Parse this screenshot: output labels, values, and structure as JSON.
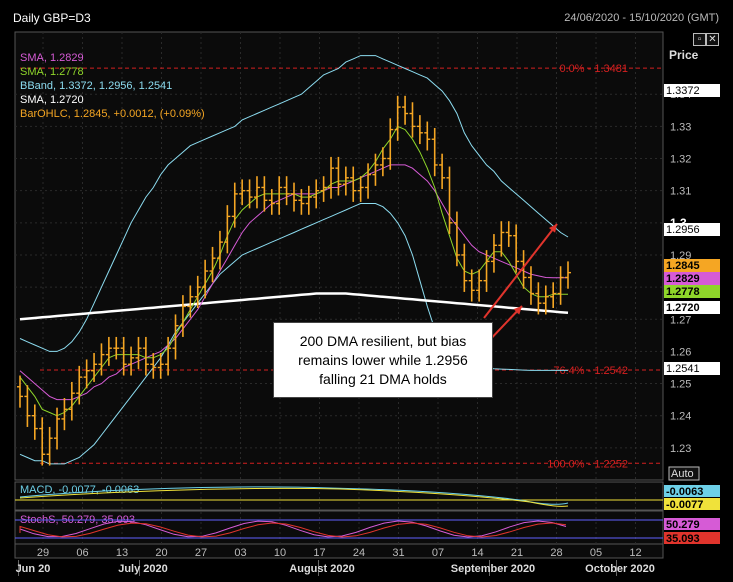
{
  "header": {
    "title": "Daily GBP=D3",
    "date_range": "24/06/2020 - 15/10/2020 (GMT)",
    "price_label": "Price",
    "auto_label": "Auto"
  },
  "legend": [
    {
      "text": "SMA, 1.2829",
      "color": "#d65bd6"
    },
    {
      "text": "SMA, 1.2778",
      "color": "#8fd62a"
    },
    {
      "text": "BBand, 1.3372, 1.2956, 1.2541",
      "color": "#8cdcf0"
    },
    {
      "text": "SMA, 1.2720",
      "color": "#ffffff"
    },
    {
      "text": "BarOHLC, 1.2845, +0.0012, (+0.09%)",
      "color": "#f5a623"
    }
  ],
  "annotation": {
    "lines": [
      "200 DMA resilient, but bias",
      "remains lower while 1.2956",
      "falling 21 DMA holds"
    ]
  },
  "colors": {
    "price": "#f5a623",
    "sma_fast": "#8fd62a",
    "sma_mid": "#d65bd6",
    "bband": "#8cdcf0",
    "sma_long": "#ffffff",
    "fib": "#d42020",
    "arrow": "#e0342c",
    "macd": "#6dd0e8",
    "signal": "#f0e23a",
    "stoch_k": "#d65bd6",
    "stoch_d": "#e0342c"
  },
  "chart_data": [
    {
      "type": "line",
      "ylim": [
        1.22,
        1.355
      ],
      "yticks": [
        1.23,
        1.24,
        1.25,
        1.26,
        1.27,
        1.28,
        1.29,
        1.3,
        1.31,
        1.32,
        1.33,
        1.34
      ],
      "xticks": [
        "29",
        "06",
        "13",
        "20",
        "27",
        "03",
        "10",
        "17",
        "24",
        "31",
        "07",
        "14",
        "21",
        "28",
        "05",
        "12"
      ],
      "months": [
        "Jun 20",
        "July 2020",
        "August 2020",
        "September 2020",
        "October 2020"
      ],
      "fib_levels": [
        {
          "label": "0.0% - 1.3481",
          "value": 1.3481
        },
        {
          "label": "76.4% - 1.2542",
          "value": 1.2542
        },
        {
          "label": "100.0% - 1.2252",
          "value": 1.2252
        }
      ],
      "price_tags": [
        {
          "text": "1.3372",
          "value": 1.3372,
          "bg": "#ffffff",
          "fg": "#000"
        },
        {
          "text": "1.2956",
          "value": 1.2956,
          "bg": "#ffffff",
          "fg": "#000"
        },
        {
          "text": "1.2845",
          "value": 1.2845,
          "bg": "#f5a623",
          "fg": "#000"
        },
        {
          "text": "1.2829",
          "value": 1.2829,
          "bg": "#d65bd6",
          "fg": "#000"
        },
        {
          "text": "1.2778",
          "value": 1.2778,
          "bg": "#8fd62a",
          "fg": "#000"
        },
        {
          "text": "1.2720",
          "value": 1.272,
          "bg": "#ffffff",
          "fg": "#000"
        },
        {
          "text": "1.2541",
          "value": 1.2541,
          "bg": "#ffffff",
          "fg": "#000"
        }
      ],
      "close": [
        1.246,
        1.24,
        1.236,
        1.228,
        1.233,
        1.239,
        1.242,
        1.247,
        1.252,
        1.254,
        1.256,
        1.259,
        1.261,
        1.261,
        1.256,
        1.258,
        1.261,
        1.256,
        1.255,
        1.256,
        1.261,
        1.268,
        1.274,
        1.277,
        1.28,
        1.285,
        1.289,
        1.294,
        1.302,
        1.309,
        1.31,
        1.308,
        1.311,
        1.307,
        1.306,
        1.311,
        1.309,
        1.307,
        1.306,
        1.308,
        1.31,
        1.311,
        1.317,
        1.312,
        1.314,
        1.31,
        1.311,
        1.315,
        1.318,
        1.32,
        1.329,
        1.336,
        1.334,
        1.33,
        1.328,
        1.326,
        1.318,
        1.314,
        1.3,
        1.29,
        1.282,
        1.279,
        1.282,
        1.288,
        1.293,
        1.297,
        1.296,
        1.288,
        1.283,
        1.278,
        1.275,
        1.277,
        1.278,
        1.283,
        1.2845
      ],
      "sma_fast": [
        1.252,
        1.249,
        1.246,
        1.242,
        1.241,
        1.24,
        1.241,
        1.243,
        1.246,
        1.249,
        1.252,
        1.255,
        1.258,
        1.259,
        1.259,
        1.259,
        1.259,
        1.258,
        1.258,
        1.259,
        1.261,
        1.265,
        1.269,
        1.273,
        1.277,
        1.281,
        1.285,
        1.29,
        1.296,
        1.301,
        1.304,
        1.306,
        1.308,
        1.309,
        1.309,
        1.309,
        1.309,
        1.309,
        1.308,
        1.308,
        1.309,
        1.31,
        1.312,
        1.313,
        1.313,
        1.313,
        1.314,
        1.316,
        1.319,
        1.323,
        1.326,
        1.33,
        1.329,
        1.326,
        1.322,
        1.317,
        1.311,
        1.303,
        1.296,
        1.289,
        1.285,
        1.284,
        1.285,
        1.288,
        1.291,
        1.291,
        1.288,
        1.284,
        1.28,
        1.278,
        1.277,
        1.277,
        1.2778,
        1.2778,
        1.2778
      ],
      "sma_mid": [
        1.254,
        1.252,
        1.25,
        1.248,
        1.246,
        1.245,
        1.245,
        1.245,
        1.246,
        1.247,
        1.249,
        1.25,
        1.252,
        1.253,
        1.255,
        1.256,
        1.257,
        1.258,
        1.259,
        1.26,
        1.262,
        1.264,
        1.267,
        1.27,
        1.273,
        1.277,
        1.281,
        1.285,
        1.289,
        1.293,
        1.297,
        1.3,
        1.302,
        1.304,
        1.306,
        1.307,
        1.308,
        1.309,
        1.309,
        1.309,
        1.309,
        1.31,
        1.311,
        1.311,
        1.312,
        1.313,
        1.314,
        1.315,
        1.316,
        1.317,
        1.318,
        1.318,
        1.318,
        1.317,
        1.315,
        1.313,
        1.31,
        1.306,
        1.302,
        1.299,
        1.296,
        1.293,
        1.291,
        1.29,
        1.289,
        1.288,
        1.287,
        1.286,
        1.285,
        1.284,
        1.2835,
        1.283,
        1.2829,
        1.2829,
        1.2829
      ],
      "bb_upper": [
        1.264,
        1.263,
        1.262,
        1.261,
        1.26,
        1.26,
        1.261,
        1.263,
        1.266,
        1.27,
        1.275,
        1.28,
        1.285,
        1.29,
        1.295,
        1.3,
        1.304,
        1.308,
        1.311,
        1.315,
        1.318,
        1.32,
        1.322,
        1.324,
        1.325,
        1.326,
        1.327,
        1.328,
        1.329,
        1.33,
        1.332,
        1.333,
        1.334,
        1.335,
        1.336,
        1.337,
        1.338,
        1.339,
        1.34,
        1.342,
        1.344,
        1.346,
        1.347,
        1.348,
        1.35,
        1.351,
        1.352,
        1.352,
        1.352,
        1.351,
        1.35,
        1.349,
        1.348,
        1.347,
        1.346,
        1.345,
        1.343,
        1.341,
        1.338,
        1.334,
        1.328,
        1.324,
        1.321,
        1.318,
        1.316,
        1.313,
        1.311,
        1.309,
        1.307,
        1.305,
        1.303,
        1.301,
        1.299,
        1.297,
        1.2956
      ],
      "bb_lower": [
        1.228,
        1.227,
        1.226,
        1.226,
        1.225,
        1.225,
        1.225,
        1.226,
        1.227,
        1.229,
        1.231,
        1.234,
        1.237,
        1.24,
        1.243,
        1.246,
        1.249,
        1.252,
        1.255,
        1.258,
        1.262,
        1.266,
        1.269,
        1.272,
        1.275,
        1.278,
        1.281,
        1.284,
        1.286,
        1.288,
        1.29,
        1.291,
        1.292,
        1.293,
        1.294,
        1.295,
        1.296,
        1.297,
        1.298,
        1.299,
        1.3,
        1.301,
        1.302,
        1.303,
        1.304,
        1.305,
        1.306,
        1.306,
        1.306,
        1.305,
        1.303,
        1.3,
        1.296,
        1.29,
        1.282,
        1.274,
        1.267,
        1.262,
        1.259,
        1.258,
        1.257,
        1.256,
        1.255,
        1.2548,
        1.2546,
        1.2545,
        1.2544,
        1.2543,
        1.2542,
        1.2541,
        1.2541,
        1.2541,
        1.2541,
        1.2541,
        1.2541
      ],
      "sma_long": [
        1.27,
        1.2702,
        1.2704,
        1.2706,
        1.2708,
        1.271,
        1.2712,
        1.2714,
        1.2716,
        1.2718,
        1.272,
        1.2722,
        1.2724,
        1.2726,
        1.2728,
        1.273,
        1.2732,
        1.2734,
        1.2736,
        1.2738,
        1.274,
        1.2742,
        1.2744,
        1.2746,
        1.2748,
        1.275,
        1.2752,
        1.2754,
        1.2756,
        1.2758,
        1.276,
        1.2762,
        1.2764,
        1.2766,
        1.2768,
        1.277,
        1.2772,
        1.2774,
        1.2776,
        1.2778,
        1.278,
        1.278,
        1.278,
        1.278,
        1.278,
        1.2778,
        1.2776,
        1.2774,
        1.2772,
        1.277,
        1.2768,
        1.2766,
        1.2764,
        1.2762,
        1.276,
        1.2758,
        1.2756,
        1.2754,
        1.2752,
        1.275,
        1.2748,
        1.2746,
        1.2744,
        1.2742,
        1.274,
        1.2738,
        1.2736,
        1.2734,
        1.2732,
        1.273,
        1.2728,
        1.2726,
        1.2724,
        1.2722,
        1.272
      ]
    },
    {
      "type": "line",
      "label": "MACD, -0.0077, -0.0063",
      "tags": [
        {
          "text": "-0.0063",
          "bg": "#6dd0e8",
          "fg": "#000"
        },
        {
          "text": "-0.0077",
          "bg": "#f0e23a",
          "fg": "#000"
        }
      ]
    },
    {
      "type": "line",
      "label": "StochS, 50.279, 35.093",
      "tags": [
        {
          "text": "50.279",
          "bg": "#d65bd6",
          "fg": "#000"
        },
        {
          "text": "35.093",
          "bg": "#e0342c",
          "fg": "#000"
        }
      ]
    }
  ]
}
